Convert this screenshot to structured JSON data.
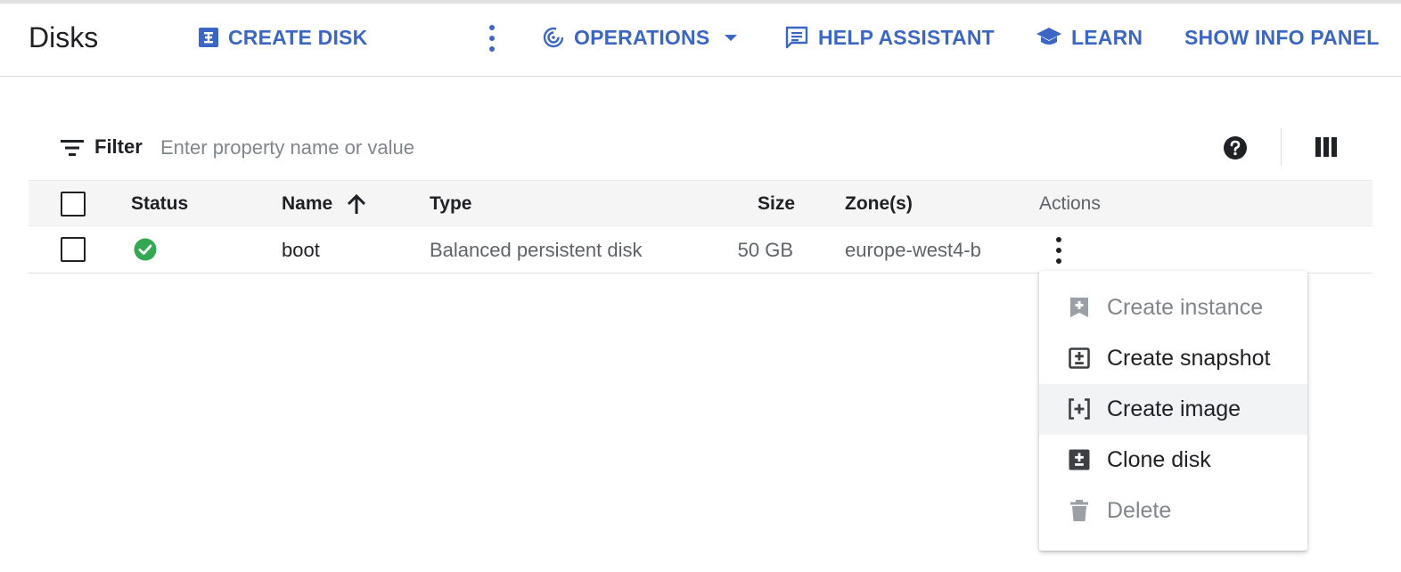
{
  "header": {
    "title": "Disks",
    "create_disk": "CREATE DISK",
    "operations": "OPERATIONS",
    "help_assistant": "HELP ASSISTANT",
    "learn": "LEARN",
    "show_info_panel": "SHOW INFO PANEL"
  },
  "filter": {
    "label": "Filter",
    "placeholder": "Enter property name or value"
  },
  "table": {
    "columns": {
      "status": "Status",
      "name": "Name",
      "type": "Type",
      "size": "Size",
      "zones": "Zone(s)",
      "actions": "Actions"
    },
    "rows": [
      {
        "status": "ok",
        "name": "boot",
        "type": "Balanced persistent disk",
        "size": "50 GB",
        "zone": "europe-west4-b"
      }
    ]
  },
  "menu": {
    "items": [
      {
        "label": "Create instance",
        "icon": "create-instance-icon",
        "disabled": true
      },
      {
        "label": "Create snapshot",
        "icon": "create-snapshot-icon",
        "disabled": false
      },
      {
        "label": "Create image",
        "icon": "create-image-icon",
        "disabled": false,
        "hovered": true
      },
      {
        "label": "Clone disk",
        "icon": "clone-disk-icon",
        "disabled": false
      },
      {
        "label": "Delete",
        "icon": "delete-icon",
        "disabled": true
      }
    ]
  },
  "colors": {
    "accent": "#3c66c4",
    "status_ok": "#34a853",
    "text": "#202124",
    "muted": "#5f6368",
    "disabled": "#80868b"
  }
}
